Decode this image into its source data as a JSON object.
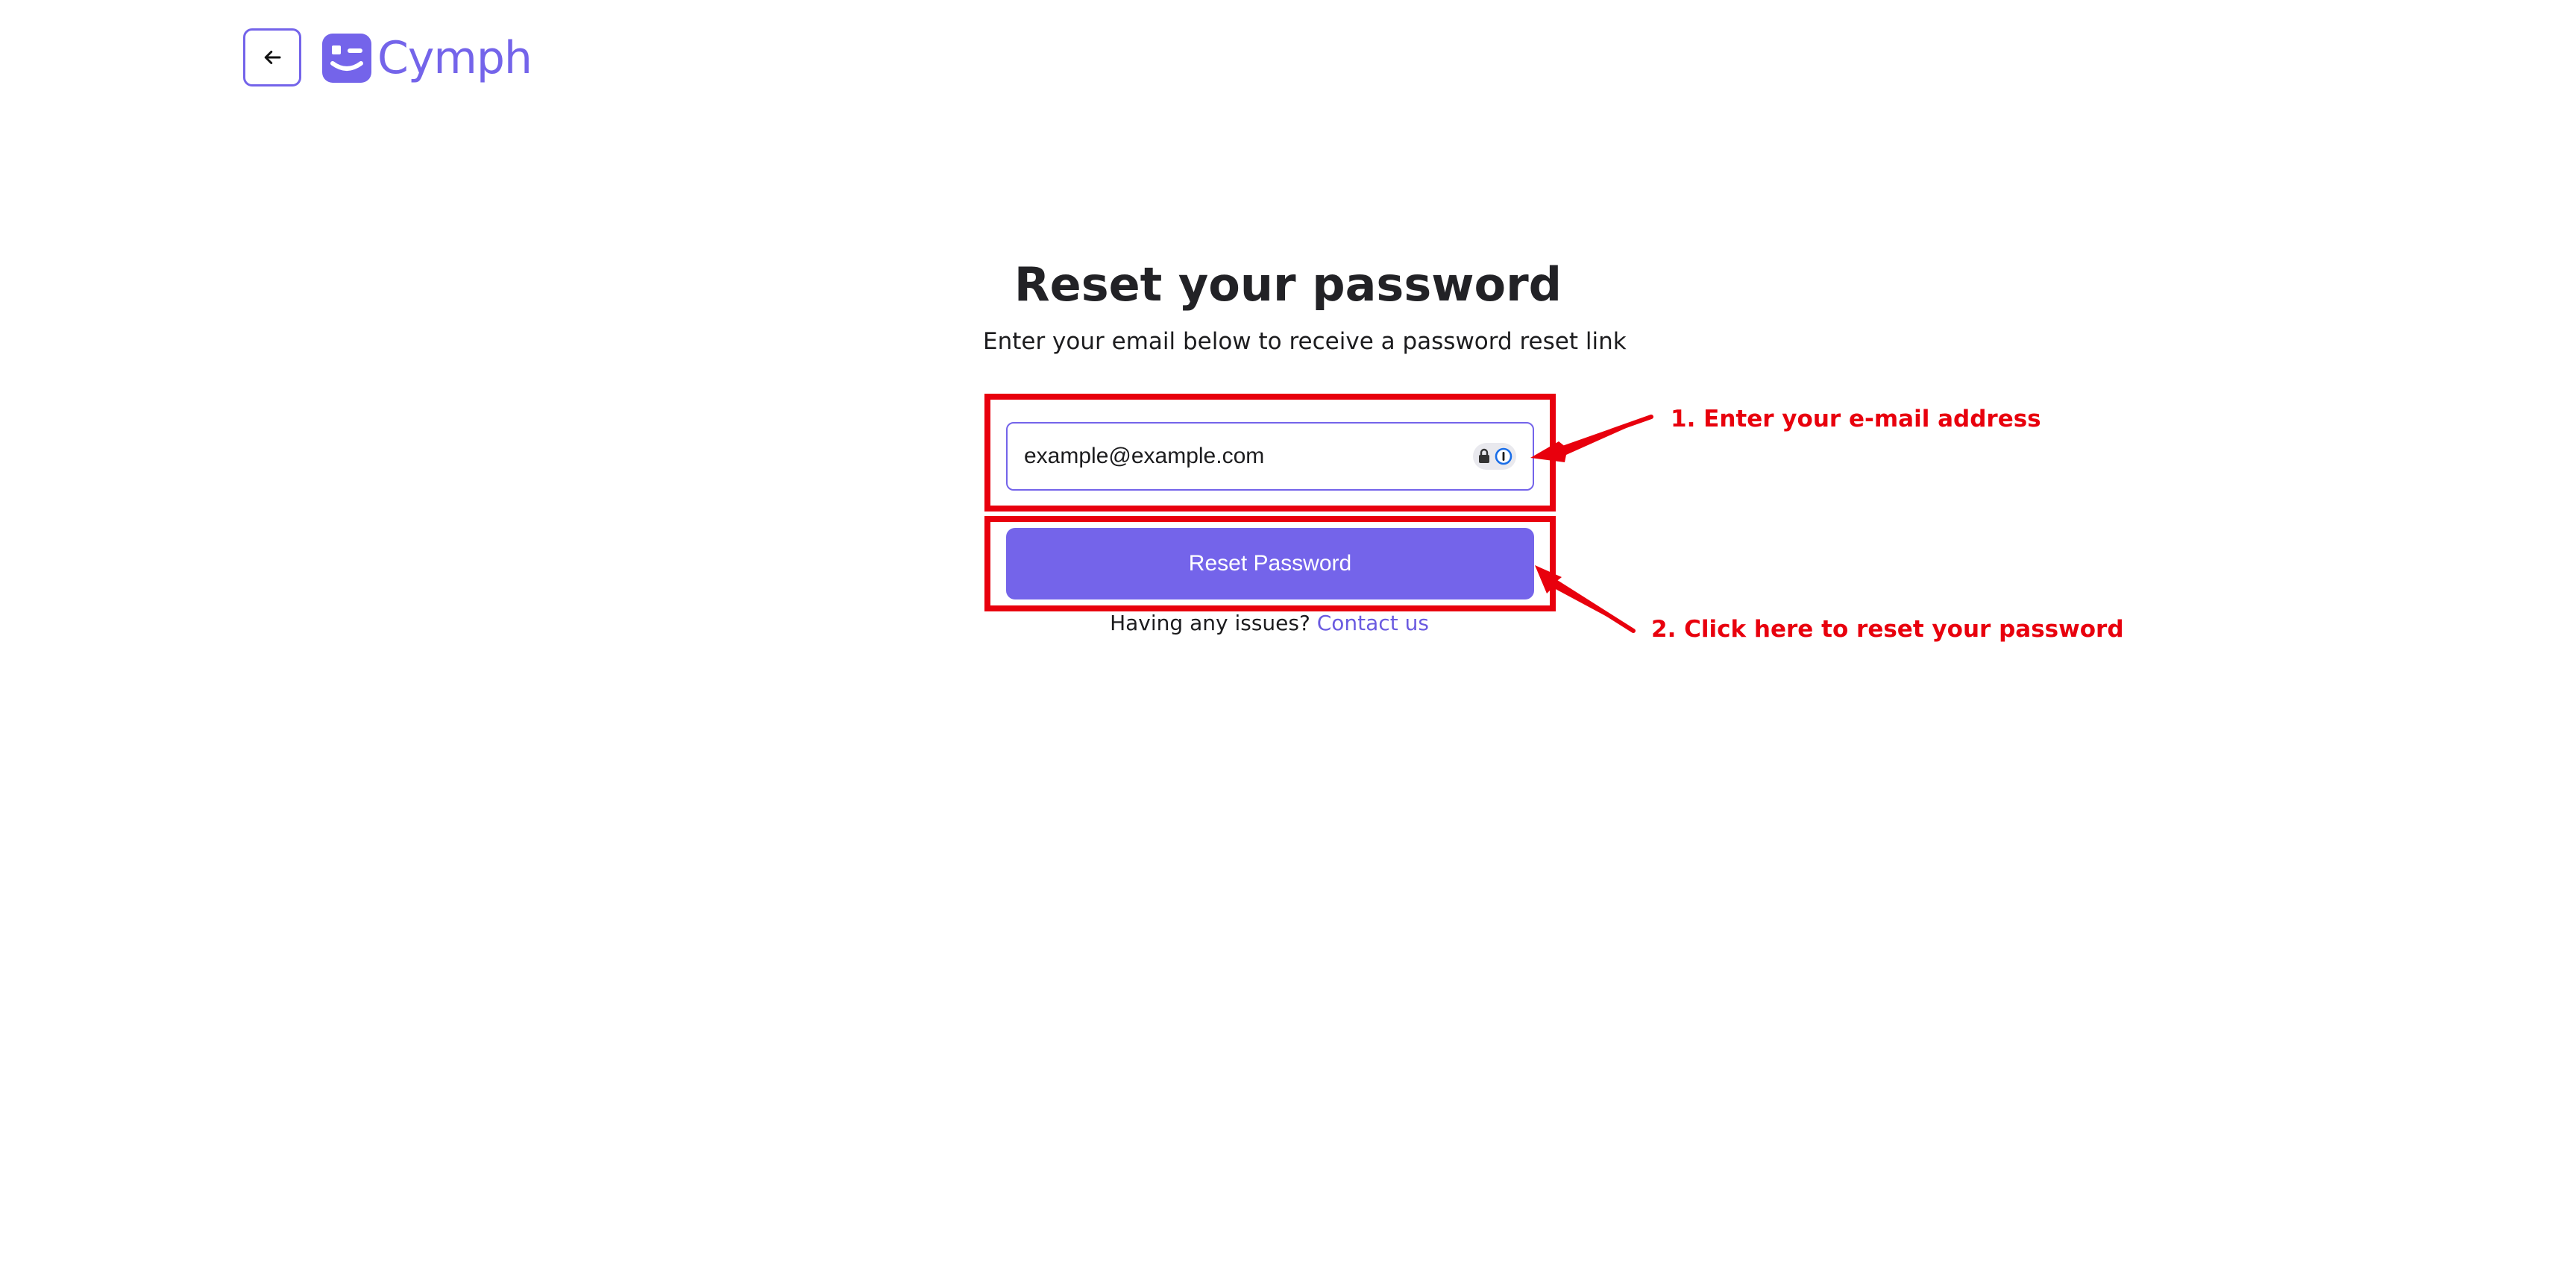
{
  "header": {
    "back_button_icon": "arrow-left-icon",
    "logo_text": "Cymph",
    "brand_color": "#7464ea"
  },
  "main": {
    "title": "Reset your password",
    "subtitle": "Enter your email below to receive a password reset link",
    "email_input": {
      "value": "example@example.com",
      "placeholder": "",
      "autofill_icon": "password-manager-icon"
    },
    "reset_button_label": "Reset Password",
    "issues_text": "Having any issues?",
    "contact_link": "Contact us"
  },
  "annotations": {
    "step1": "1. Enter your e-mail address",
    "step2": "2. Click here to reset your password",
    "color": "#e8000d"
  }
}
